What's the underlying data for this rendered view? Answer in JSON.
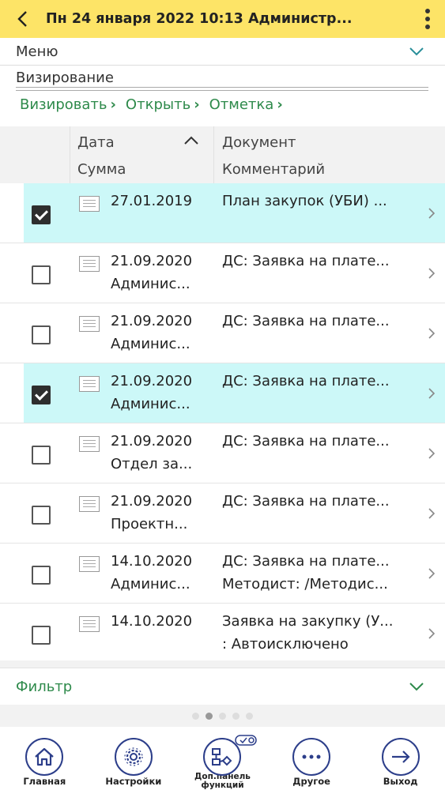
{
  "header": {
    "title": "Пн 24 января 2022 10:13 Администр..."
  },
  "menu": {
    "label": "Меню"
  },
  "section": {
    "title": "Визирование"
  },
  "actions": [
    {
      "label": "Визировать"
    },
    {
      "label": "Открыть"
    },
    {
      "label": "Отметка"
    }
  ],
  "table": {
    "headers": {
      "date": "Дата",
      "sum": "Сумма",
      "document": "Документ",
      "comment": "Комментарий"
    },
    "rows": [
      {
        "checked": true,
        "date": "27.01.2019",
        "sub": "",
        "doc": "План закупок (УБИ) ...",
        "comment": ""
      },
      {
        "checked": false,
        "date": "21.09.2020",
        "sub": "Админис...",
        "doc": "ДС: Заявка на плате...",
        "comment": ""
      },
      {
        "checked": false,
        "date": "21.09.2020",
        "sub": "Админис...",
        "doc": "ДС: Заявка на плате...",
        "comment": ""
      },
      {
        "checked": true,
        "date": "21.09.2020",
        "sub": "Админис...",
        "doc": "ДС: Заявка на плате...",
        "comment": ""
      },
      {
        "checked": false,
        "date": "21.09.2020",
        "sub": "Отдел за...",
        "doc": "ДС: Заявка на плате...",
        "comment": ""
      },
      {
        "checked": false,
        "date": "21.09.2020",
        "sub": "Проектн...",
        "doc": "ДС: Заявка на плате...",
        "comment": ""
      },
      {
        "checked": false,
        "date": "14.10.2020",
        "sub": "Админис...",
        "doc": "ДС: Заявка на плате...",
        "comment": "Методист: /Методис..."
      },
      {
        "checked": false,
        "date": "14.10.2020",
        "sub": "",
        "doc": "Заявка на закупку (У...",
        "comment": ": Автоисключено"
      }
    ]
  },
  "filter": {
    "label": "Фильтр"
  },
  "pager": {
    "count": 5,
    "active": 2
  },
  "bottom_nav": {
    "home": "Главная",
    "settings": "Настройки",
    "extra_line1": "Доп.панель",
    "extra_line2": "функций",
    "other": "Другое",
    "exit": "Выход"
  },
  "colors": {
    "header_bg": "#fde467",
    "accent_green": "#2e8a4b",
    "selected_row": "#ccf8f8",
    "nav_icon": "#2c3e8a"
  }
}
